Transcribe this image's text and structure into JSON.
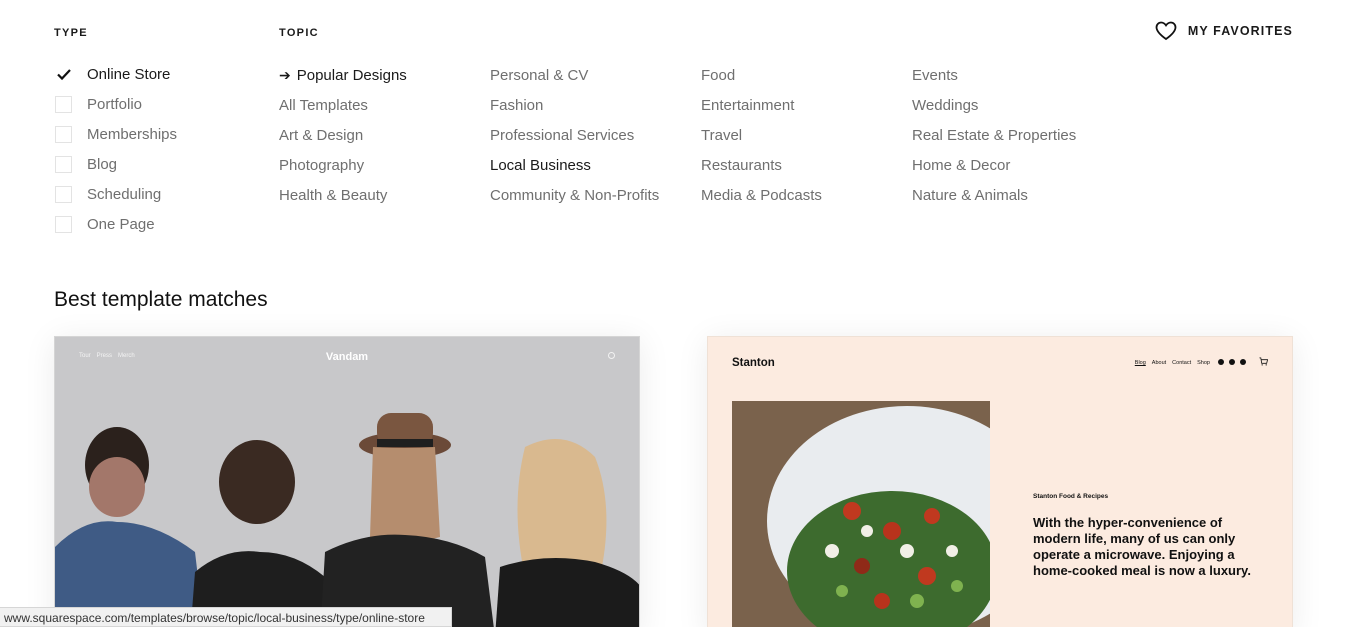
{
  "type_filter": {
    "heading": "TYPE",
    "items": [
      {
        "label": "Online Store",
        "checked": true
      },
      {
        "label": "Portfolio",
        "checked": false
      },
      {
        "label": "Memberships",
        "checked": false
      },
      {
        "label": "Blog",
        "checked": false
      },
      {
        "label": "Scheduling",
        "checked": false
      },
      {
        "label": "One Page",
        "checked": false
      }
    ]
  },
  "topic_filter": {
    "heading": "TOPIC",
    "columns": [
      [
        "Popular Designs",
        "All Templates",
        "Art & Design",
        "Photography",
        "Health & Beauty"
      ],
      [
        "Personal & CV",
        "Fashion",
        "Professional Services",
        "Local Business",
        "Community & Non-Profits"
      ],
      [
        "Food",
        "Entertainment",
        "Travel",
        "Restaurants",
        "Media & Podcasts"
      ],
      [
        "Events",
        "Weddings",
        "Real Estate & Properties",
        "Home & Decor",
        "Nature & Animals"
      ]
    ],
    "active": [
      "Popular Designs",
      "Local Business"
    ]
  },
  "favorites": {
    "label": "MY FAVORITES",
    "icon": "heart-icon"
  },
  "section_title": "Best template matches",
  "cards": {
    "vandam": {
      "title": "Vandam",
      "nav": [
        "Tour",
        "Press",
        "Merch"
      ],
      "background": "#c9c9cb"
    },
    "stanton": {
      "logo": "Stanton",
      "nav": [
        "Blog",
        "About",
        "Contact",
        "Shop"
      ],
      "kicker": "Stanton Food & Recipes",
      "body": "With the hyper-convenience of modern life, many of us can only operate a microwave. Enjoying a home-cooked meal is now a luxury.",
      "background": "#fcebe0"
    }
  },
  "status_bar": {
    "url": "www.squarespace.com/templates/browse/topic/local-business/type/online-store"
  }
}
